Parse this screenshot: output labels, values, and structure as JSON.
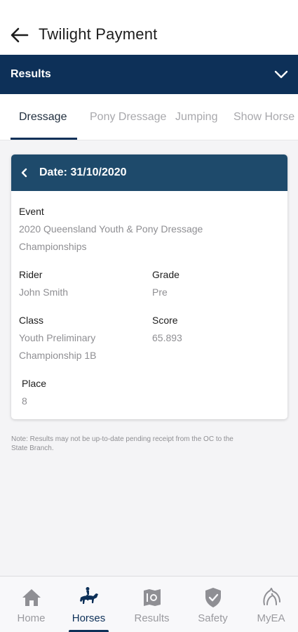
{
  "header": {
    "title": "Twilight Payment"
  },
  "results_bar": {
    "label": "Results"
  },
  "tabs": [
    {
      "label": "Dressage",
      "active": true
    },
    {
      "label": "Pony Dressage",
      "active": false
    },
    {
      "label": "Jumping",
      "active": false
    },
    {
      "label": "Show Horse",
      "active": false
    }
  ],
  "card": {
    "date": "Date: 31/10/2020",
    "event": {
      "label": "Event",
      "value_line1": "2020 Queensland Youth & Pony Dressage",
      "value_line2": "Championships"
    },
    "rider": {
      "label": "Rider",
      "value": "John Smith"
    },
    "grade": {
      "label": "Grade",
      "value": "Pre"
    },
    "class": {
      "label": "Class",
      "value_line1": "Youth Preliminary",
      "value_line2": "Championship 1B"
    },
    "score": {
      "label": "Score",
      "value": "65.893"
    },
    "place": {
      "label": "Place",
      "value": "8"
    }
  },
  "note": {
    "line1": "Note: Results may not be up-to-date pending receipt from the OC to the",
    "line2": "State Branch."
  },
  "bottom_nav": [
    {
      "label": "Home",
      "icon": "home-icon",
      "active": false
    },
    {
      "label": "Horses",
      "icon": "horse-rider-icon",
      "active": true
    },
    {
      "label": "Results",
      "icon": "results-icon",
      "active": false
    },
    {
      "label": "Safety",
      "icon": "shield-check-icon",
      "active": false
    },
    {
      "label": "MyEA",
      "icon": "horse-head-icon",
      "active": false
    }
  ],
  "colors": {
    "primary": "#0d3058",
    "card_header": "#1e4a6b",
    "muted": "#8f8f93"
  }
}
